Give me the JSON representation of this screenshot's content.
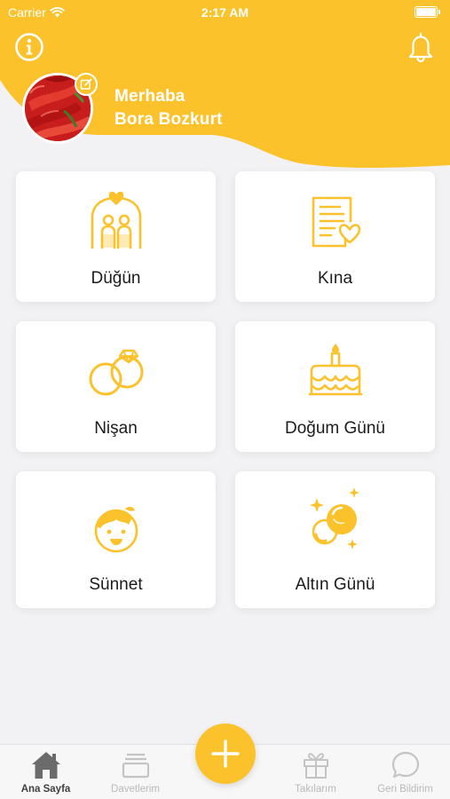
{
  "colors": {
    "accent": "#FBC22B",
    "background": "#F2F2F4",
    "card": "#FFFFFF",
    "text": "#1B1B1B",
    "tab_inactive": "#B9B9B9",
    "tab_active": "#3F3F3F"
  },
  "status_bar": {
    "carrier": "Carrier",
    "time": "2:17 AM"
  },
  "header": {
    "info_icon": "info-circle-icon",
    "notification_icon": "bell-icon",
    "greeting": "Merhaba",
    "user_name": "Bora Bozkurt",
    "avatar_edit_icon": "edit-icon"
  },
  "categories": [
    {
      "label": "Düğün",
      "icon": "wedding-couple-icon"
    },
    {
      "label": "Kına",
      "icon": "document-heart-icon"
    },
    {
      "label": "Nişan",
      "icon": "rings-icon"
    },
    {
      "label": "Doğum Günü",
      "icon": "birthday-cake-icon"
    },
    {
      "label": "Sünnet",
      "icon": "boy-face-icon"
    },
    {
      "label": "Altın Günü",
      "icon": "gold-coins-icon"
    }
  ],
  "tabbar": {
    "tabs": [
      {
        "label": "Ana Sayfa",
        "icon": "home-icon",
        "active": true
      },
      {
        "label": "Davetlerim",
        "icon": "invitations-icon",
        "active": false
      },
      {
        "label": "Takılarım",
        "icon": "gift-icon",
        "active": false
      },
      {
        "label": "Geri Bildirim",
        "icon": "chat-bubble-icon",
        "active": false
      }
    ],
    "add_icon": "plus-icon"
  }
}
